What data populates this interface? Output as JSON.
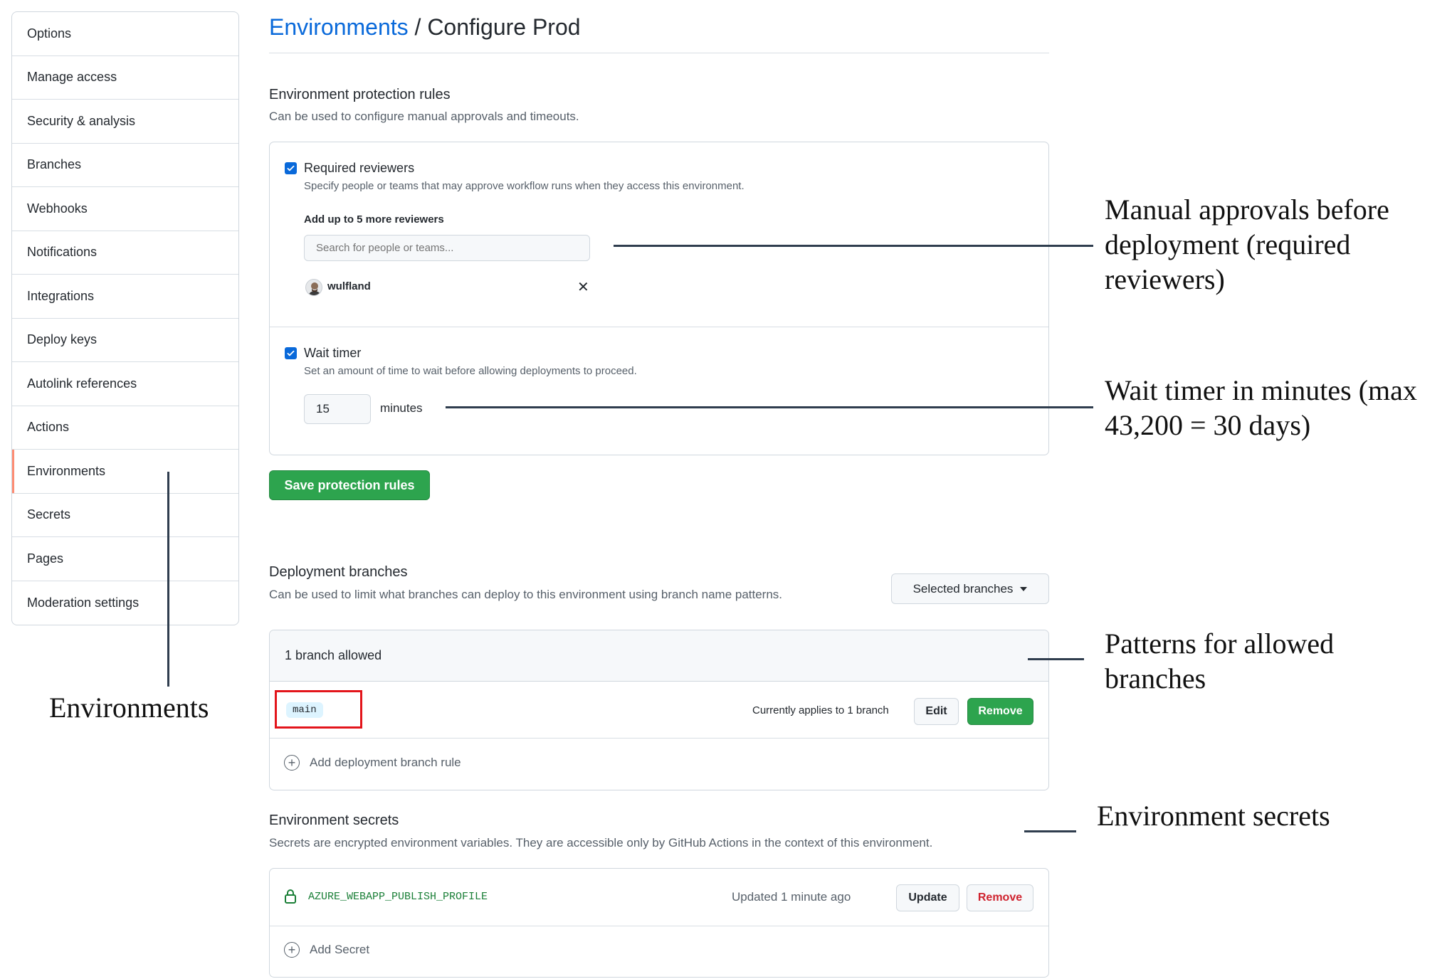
{
  "sidebar": {
    "items": [
      {
        "label": "Options"
      },
      {
        "label": "Manage access"
      },
      {
        "label": "Security & analysis"
      },
      {
        "label": "Branches"
      },
      {
        "label": "Webhooks"
      },
      {
        "label": "Notifications"
      },
      {
        "label": "Integrations"
      },
      {
        "label": "Deploy keys"
      },
      {
        "label": "Autolink references"
      },
      {
        "label": "Actions"
      },
      {
        "label": "Environments",
        "selected": true
      },
      {
        "label": "Secrets"
      },
      {
        "label": "Pages"
      },
      {
        "label": "Moderation settings"
      }
    ]
  },
  "header": {
    "crumb": "Environments",
    "separator": " / ",
    "title": "Configure Prod"
  },
  "protection": {
    "heading": "Environment protection rules",
    "description": "Can be used to configure manual approvals and timeouts.",
    "reviewers": {
      "checked": true,
      "label": "Required reviewers",
      "description": "Specify people or teams that may approve workflow runs when they access this environment.",
      "add_label": "Add up to 5 more reviewers",
      "search_placeholder": "Search for people or teams...",
      "user": "wulfland",
      "remove_icon": "x-icon"
    },
    "wait_timer": {
      "checked": true,
      "label": "Wait timer",
      "description": "Set an amount of time to wait before allowing deployments to proceed.",
      "value": "15",
      "unit": "minutes"
    },
    "save_label": "Save protection rules"
  },
  "deployment": {
    "heading": "Deployment branches",
    "description": "Can be used to limit what branches can deploy to this environment using branch name patterns.",
    "dropdown_label": "Selected branches",
    "allowed_count": "1 branch allowed",
    "rules": [
      {
        "pattern": "main",
        "applies": "Currently applies to 1 branch",
        "edit_label": "Edit",
        "remove_label": "Remove"
      }
    ],
    "add_rule_label": "Add deployment branch rule"
  },
  "secrets": {
    "heading": "Environment secrets",
    "description": "Secrets are encrypted environment variables. They are accessible only by GitHub Actions in the context of this environment.",
    "items": [
      {
        "name": "AZURE_WEBAPP_PUBLISH_PROFILE",
        "updated": "Updated 1 minute ago",
        "update_label": "Update",
        "remove_label": "Remove"
      }
    ],
    "add_label": "Add Secret"
  },
  "annotations": {
    "reviewers": "Manual approvals before deployment (required reviewers)",
    "wait_timer": "Wait timer in minutes (max 43,200 = 30 days)",
    "branches": "Patterns for allowed branches",
    "secrets": "Environment secrets",
    "environments": "Environments"
  },
  "colors": {
    "accent_blue": "#0969da",
    "success_green": "#2da44e",
    "danger_red": "#cf222e",
    "highlight_red": "#e3151b",
    "selected_marker": "#fd8c73"
  }
}
